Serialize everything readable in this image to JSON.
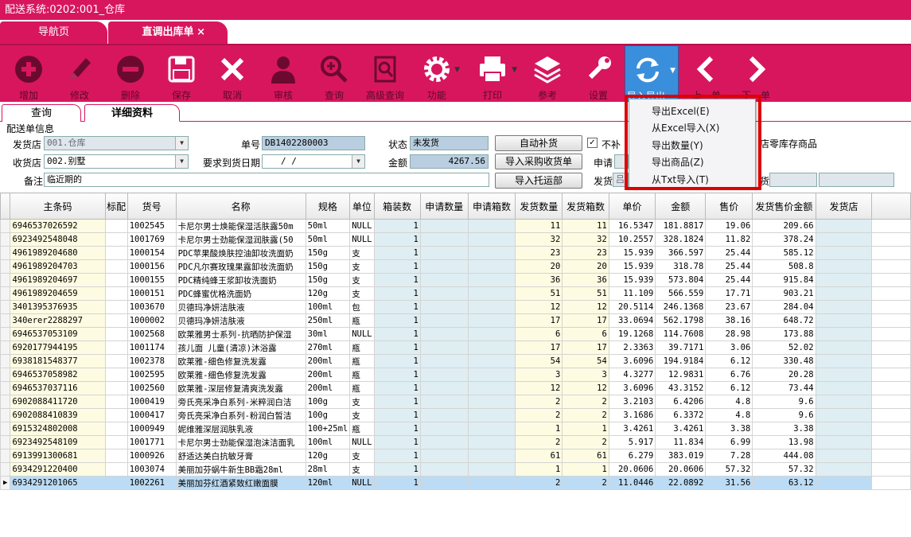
{
  "window": {
    "title": "配送系统:0202:001_仓库"
  },
  "tabs": [
    {
      "label": "导航页"
    },
    {
      "label": "直调出库单"
    }
  ],
  "tab_close": "×",
  "toolbar": {
    "items": [
      {
        "label": "增加",
        "icon": "plus-circle-icon"
      },
      {
        "label": "修改",
        "icon": "pencil-icon"
      },
      {
        "label": "删除",
        "icon": "minus-circle-icon"
      },
      {
        "label": "保存",
        "icon": "floppy-icon"
      },
      {
        "label": "取消",
        "icon": "x-icon"
      },
      {
        "label": "审核",
        "icon": "person-icon"
      },
      {
        "label": "查询",
        "icon": "magnifier-plus-icon"
      },
      {
        "label": "高级查询",
        "icon": "advanced-search-icon"
      },
      {
        "label": "功能",
        "icon": "gear-icon"
      },
      {
        "label": "打印",
        "icon": "printer-icon"
      },
      {
        "label": "参考",
        "icon": "layers-icon"
      },
      {
        "label": "设置",
        "icon": "wrench-icon"
      },
      {
        "label": "导入导出",
        "icon": "refresh-icon"
      },
      {
        "label": "上一单",
        "icon": "chevron-left-icon"
      },
      {
        "label": "下一单",
        "icon": "chevron-right-icon"
      }
    ],
    "colors": {
      "bar": "#d8165e",
      "selected": "#3a8fdc"
    }
  },
  "subtabs": [
    {
      "label": "查询"
    },
    {
      "label": "详细资料"
    }
  ],
  "form": {
    "section_title": "配送单信息",
    "send_store_label": "发货店",
    "send_store_value": "001.仓库",
    "order_no_label": "单号",
    "order_no_value": "DB1402280003",
    "status_label": "状态",
    "status_value": "未发货",
    "auto_fill_btn": "自动补货",
    "no_fill_label": "不补",
    "receive_store_label": "收货店",
    "receive_store_value": "002.别墅",
    "arrival_date_label": "要求到货日期",
    "arrival_date_value": "/ /",
    "amount_label": "金额",
    "amount_value": "4267.56",
    "import_receipt_btn": "导入采购收货单",
    "apply_label": "申请",
    "remark_label": "备注",
    "remark_value": "临近期的",
    "import_consign_btn": "导入托运部",
    "ship_label": "发货",
    "ship_value": "吕",
    "ship_right_label": "货",
    "zero_stock_text": "店零库存商品"
  },
  "table": {
    "columns": [
      "主条码",
      "标配",
      "货号",
      "名称",
      "规格",
      "单位",
      "箱装数",
      "申请数量",
      "申请箱数",
      "发货数量",
      "发货箱数",
      "单价",
      "金额",
      "售价",
      "发货售价金额",
      "发货店"
    ],
    "rows": [
      [
        "6946537026592",
        "",
        "1002545",
        "卡尼尔男士焕能保湿活肤露50m",
        "50ml",
        "NULL",
        "1",
        "",
        "",
        "11",
        "11",
        "16.5347",
        "181.8817",
        "19.06",
        "209.66"
      ],
      [
        "6923492548048",
        "",
        "1001769",
        "卡尼尔男士劲能保湿润肤露(50",
        "50ml",
        "NULL",
        "1",
        "",
        "",
        "32",
        "32",
        "10.2557",
        "328.1824",
        "11.82",
        "378.24"
      ],
      [
        "4961989204680",
        "",
        "1000154",
        "PDC苹果酸焕肤控油卸妆洗面奶",
        "150g",
        "支",
        "1",
        "",
        "",
        "23",
        "23",
        "15.939",
        "366.597",
        "25.44",
        "585.12"
      ],
      [
        "4961989204703",
        "",
        "1000156",
        "PDC凡尔赛玫瑰果露卸妆洗面奶",
        "150g",
        "支",
        "1",
        "",
        "",
        "20",
        "20",
        "15.939",
        "318.78",
        "25.44",
        "508.8"
      ],
      [
        "4961989204697",
        "",
        "1000155",
        "PDC精纯蜂王浆卸妆洗面奶",
        "150g",
        "支",
        "1",
        "",
        "",
        "36",
        "36",
        "15.939",
        "573.804",
        "25.44",
        "915.84"
      ],
      [
        "4961989204659",
        "",
        "1000151",
        "PDC蜂蜜优格洗面奶",
        "120g",
        "支",
        "1",
        "",
        "",
        "51",
        "51",
        "11.109",
        "566.559",
        "17.71",
        "903.21"
      ],
      [
        "3401395376935",
        "",
        "1003670",
        "贝德玛净妍洁肤液",
        "100ml",
        "包",
        "1",
        "",
        "",
        "12",
        "12",
        "20.5114",
        "246.1368",
        "23.67",
        "284.04"
      ],
      [
        "340erer2288297",
        "",
        "1000002",
        "贝德玛净妍洁肤液",
        "250ml",
        "瓶",
        "1",
        "",
        "",
        "17",
        "17",
        "33.0694",
        "562.1798",
        "38.16",
        "648.72"
      ],
      [
        "6946537053109",
        "",
        "1002568",
        "欧莱雅男士系列-抗晒防护保湿",
        "30ml",
        "NULL",
        "1",
        "",
        "",
        "6",
        "6",
        "19.1268",
        "114.7608",
        "28.98",
        "173.88"
      ],
      [
        "6920177944195",
        "",
        "1001174",
        "孩儿面 儿童(清凉)沐浴露",
        "270ml",
        "瓶",
        "1",
        "",
        "",
        "17",
        "17",
        "2.3363",
        "39.7171",
        "3.06",
        "52.02"
      ],
      [
        "6938181548377",
        "",
        "1002378",
        "欧莱雅-细色修复洗发露",
        "200ml",
        "瓶",
        "1",
        "",
        "",
        "54",
        "54",
        "3.6096",
        "194.9184",
        "6.12",
        "330.48"
      ],
      [
        "6946537058982",
        "",
        "1002595",
        "欧莱雅-细色修复洗发露",
        "200ml",
        "瓶",
        "1",
        "",
        "",
        "3",
        "3",
        "4.3277",
        "12.9831",
        "6.76",
        "20.28"
      ],
      [
        "6946537037116",
        "",
        "1002560",
        "欧莱雅-深层修复清爽洗发露",
        "200ml",
        "瓶",
        "1",
        "",
        "",
        "12",
        "12",
        "3.6096",
        "43.3152",
        "6.12",
        "73.44"
      ],
      [
        "6902088411720",
        "",
        "1000419",
        "旁氏亮采净白系列-米粹润白洁",
        "100g",
        "支",
        "1",
        "",
        "",
        "2",
        "2",
        "3.2103",
        "6.4206",
        "4.8",
        "9.6"
      ],
      [
        "6902088410839",
        "",
        "1000417",
        "旁氏亮采净白系列-粉润白皙洁",
        "100g",
        "支",
        "1",
        "",
        "",
        "2",
        "2",
        "3.1686",
        "6.3372",
        "4.8",
        "9.6"
      ],
      [
        "6915324802008",
        "",
        "1000949",
        "妮维雅深层润肤乳液",
        "100+25ml",
        "瓶",
        "1",
        "",
        "",
        "1",
        "1",
        "3.4261",
        "3.4261",
        "3.38",
        "3.38"
      ],
      [
        "6923492548109",
        "",
        "1001771",
        "卡尼尔男士劲能保湿泡沫洁面乳",
        "100ml",
        "NULL",
        "1",
        "",
        "",
        "2",
        "2",
        "5.917",
        "11.834",
        "6.99",
        "13.98"
      ],
      [
        "6913991300681",
        "",
        "1000926",
        "舒适达美白抗敏牙膏",
        "120g",
        "支",
        "1",
        "",
        "",
        "61",
        "61",
        "6.279",
        "383.019",
        "7.28",
        "444.08"
      ],
      [
        "6934291220400",
        "",
        "1003074",
        "美丽加芬蜗牛新生BB霜28ml",
        "28ml",
        "支",
        "1",
        "",
        "",
        "1",
        "1",
        "20.0606",
        "20.0606",
        "57.32",
        "57.32"
      ],
      [
        "6934291201065",
        "",
        "1002261",
        "美丽加芬红酒紧致红嫩面膜",
        "120ml",
        "NULL",
        "1",
        "",
        "",
        "2",
        "2",
        "11.0446",
        "22.0892",
        "31.56",
        "63.12"
      ]
    ]
  },
  "export_menu": {
    "items": [
      {
        "label": "导出Excel(E)"
      },
      {
        "label": "从Excel导入(X)"
      },
      {
        "label": "导出数量(Y)"
      },
      {
        "label": "导出商品(Z)"
      },
      {
        "label": "从Txt导入(T)"
      }
    ],
    "highlight_color": "#e00000"
  }
}
